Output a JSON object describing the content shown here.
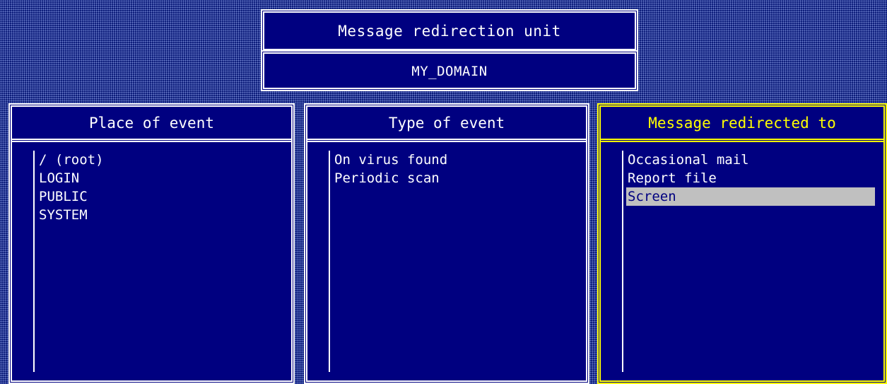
{
  "header": {
    "title": "Message redirection unit",
    "domain": "MY_DOMAIN"
  },
  "panels": [
    {
      "title": "Place of event",
      "items": [
        "/ (root)",
        "LOGIN",
        "PUBLIC",
        "SYSTEM"
      ]
    },
    {
      "title": "Type of event",
      "items": [
        "On virus found",
        "Periodic scan"
      ]
    },
    {
      "title": "Message redirected to",
      "items": [
        "Occasional mail",
        "Report file",
        "Screen"
      ],
      "selected": "Screen"
    }
  ],
  "colors": {
    "background": "#000080",
    "text": "#ffffff",
    "active_border": "#ffff00",
    "selection": "#c0c0c0"
  }
}
